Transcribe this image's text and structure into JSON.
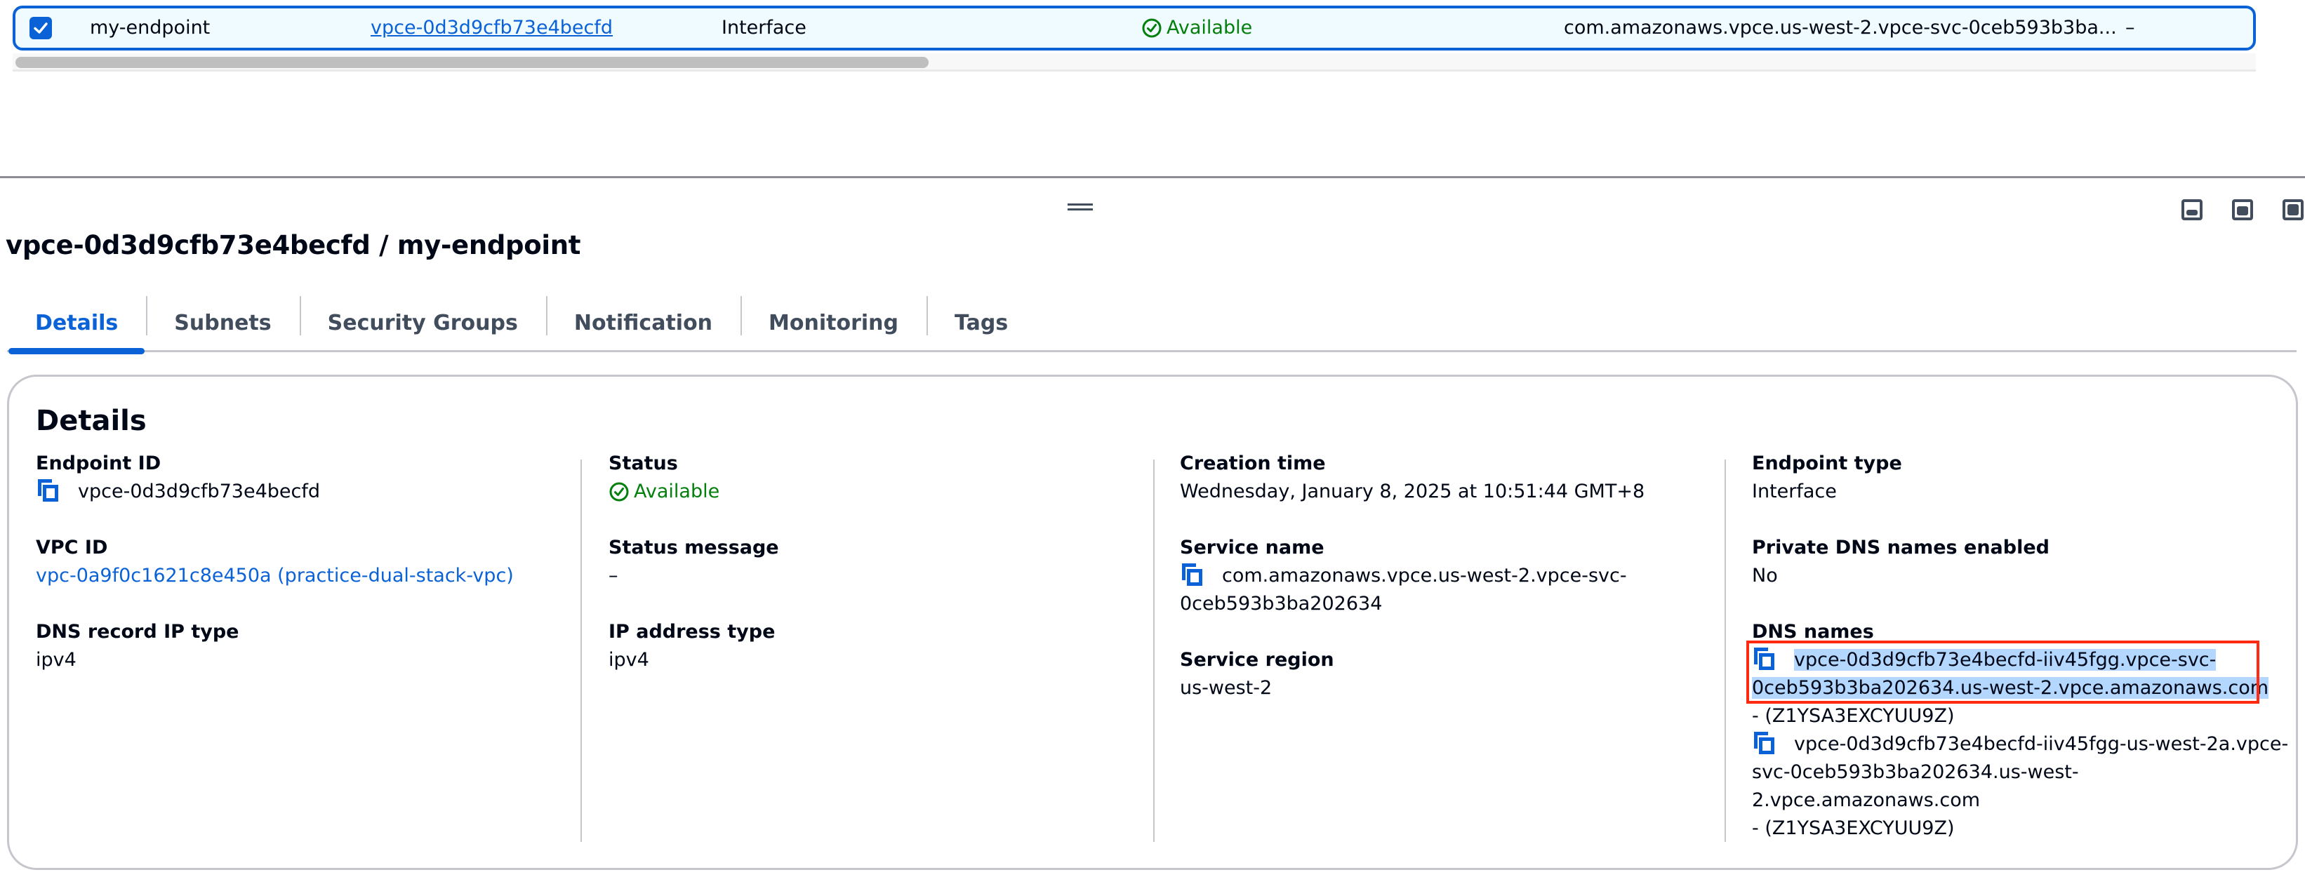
{
  "table": {
    "selected_row": {
      "checked": true,
      "name": "my-endpoint",
      "endpoint_id": "vpce-0d3d9cfb73e4becfd",
      "endpoint_type": "Interface",
      "status": "Available",
      "service_name": "com.amazonaws.vpce.us-west-2.vpce-svc-0ceb593b3ba...",
      "extra": "–"
    }
  },
  "detail": {
    "title": "vpce-0d3d9cfb73e4becfd / my-endpoint",
    "tabs": [
      {
        "label": "Details",
        "active": true
      },
      {
        "label": "Subnets",
        "active": false
      },
      {
        "label": "Security Groups",
        "active": false
      },
      {
        "label": "Notification",
        "active": false
      },
      {
        "label": "Monitoring",
        "active": false
      },
      {
        "label": "Tags",
        "active": false
      }
    ],
    "section_heading": "Details",
    "col1": {
      "endpoint_id_label": "Endpoint ID",
      "endpoint_id": "vpce-0d3d9cfb73e4becfd",
      "vpc_id_label": "VPC ID",
      "vpc_id": "vpc-0a9f0c1621c8e450a (practice-dual-stack-vpc)",
      "dns_record_ip_type_label": "DNS record IP type",
      "dns_record_ip_type": "ipv4"
    },
    "col2": {
      "status_label": "Status",
      "status": "Available",
      "status_message_label": "Status message",
      "status_message": "–",
      "ip_address_type_label": "IP address type",
      "ip_address_type": "ipv4"
    },
    "col3": {
      "creation_time_label": "Creation time",
      "creation_time": "Wednesday, January 8, 2025 at 10:51:44 GMT+8",
      "service_name_label": "Service name",
      "service_name_line1": "com.amazonaws.vpce.us-west-2.vpce-svc-",
      "service_name_line2": "0ceb593b3ba202634",
      "service_region_label": "Service region",
      "service_region": "us-west-2"
    },
    "col4": {
      "endpoint_type_label": "Endpoint type",
      "endpoint_type": "Interface",
      "private_dns_label": "Private DNS names enabled",
      "private_dns": "No",
      "dns_names_label": "DNS names",
      "dns_names": [
        {
          "line1": "vpce-0d3d9cfb73e4becfd-iiv45fgg.vpce-svc-",
          "line2": "0ceb593b3ba202634.us-west-2.vpce.amazonaws.com",
          "zone": "- (Z1YSA3EXCYUU9Z)",
          "selected": true
        },
        {
          "line1": "vpce-0d3d9cfb73e4becfd-iiv45fgg-us-west-2a.vpce-",
          "line2": "svc-0ceb593b3ba202634.us-west-",
          "line3": "2.vpce.amazonaws.com",
          "zone": "- (Z1YSA3EXCYUU9Z)",
          "selected": false
        }
      ]
    }
  },
  "colors": {
    "accent": "#0a62d6",
    "success": "#037f0c",
    "selection": "#b4d7ff",
    "annotation_box": "#ff2a0f"
  }
}
